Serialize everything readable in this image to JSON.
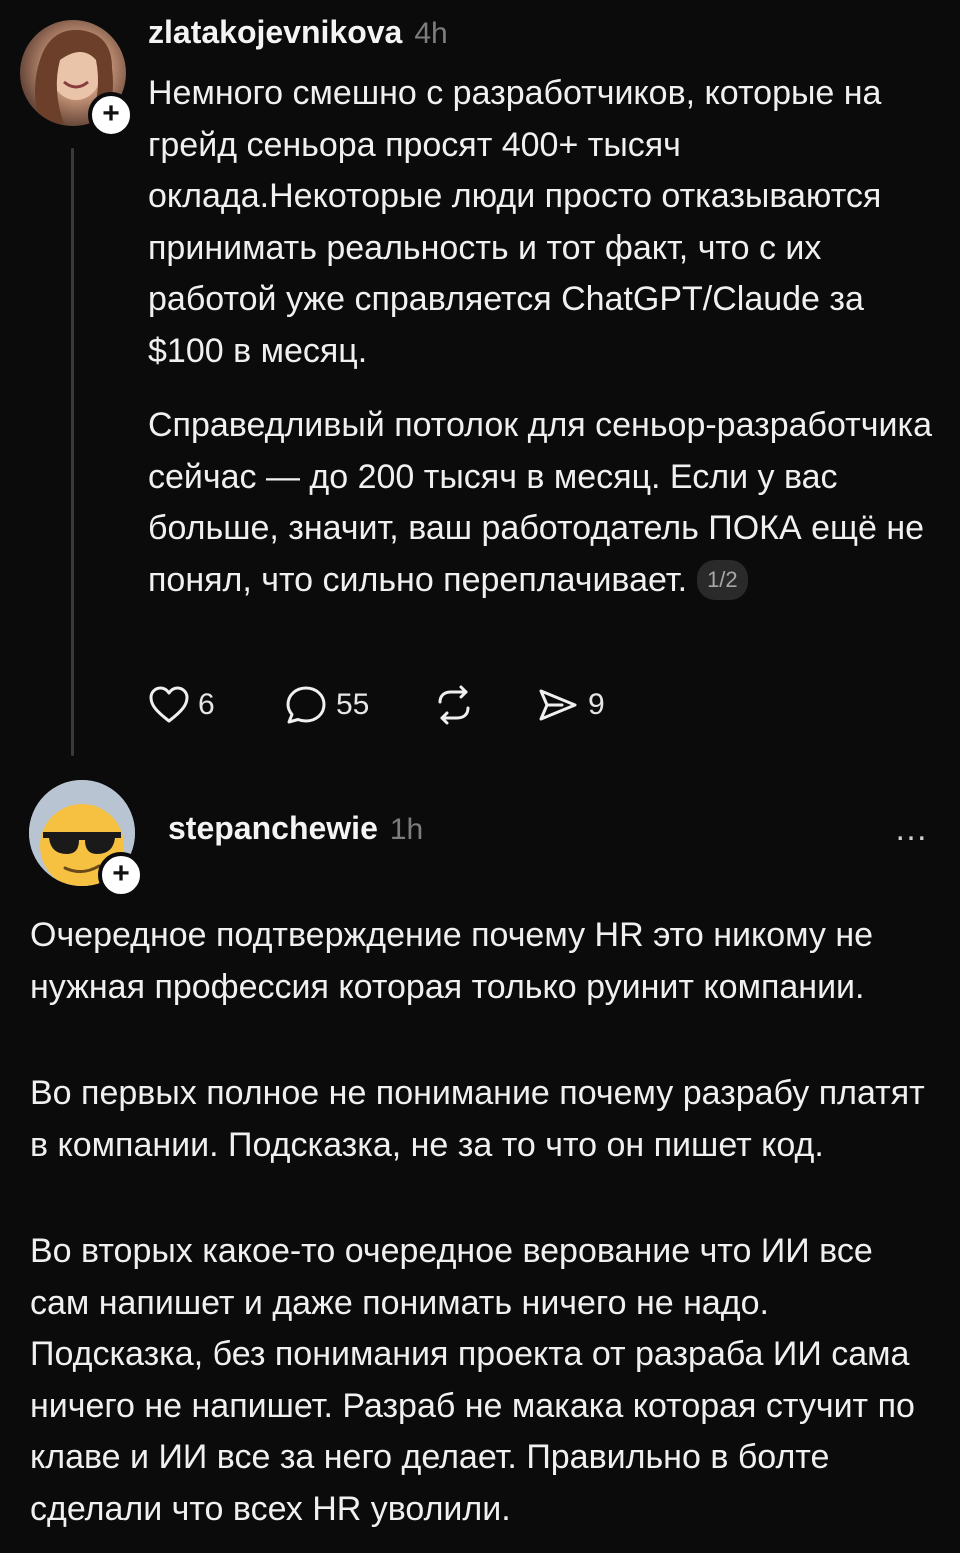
{
  "post1": {
    "username": "zlatakojevnikova",
    "time": "4h",
    "paragraph1": "Немного смешно с разработчиков, которые на грейд сеньора просят 400+ тысяч оклада.Некоторые люди просто отказываются принимать реальность и тот факт, что с их работой уже справляется ChatGPT/Claude за $100 в месяц.",
    "paragraph2": "Справедливый потолок для сеньор-разработчика сейчас — до 200 тысяч в месяц. Если у вас больше, значит, ваш работодатель ПОКА ещё не понял, что сильно переплачивает.",
    "page_indicator": "1/2",
    "actions": {
      "likes": "6",
      "replies": "55",
      "shares": "9"
    }
  },
  "post2": {
    "username": "stepanchewie",
    "time": "1h",
    "more": "…",
    "paragraph1": "Очередное подтверждение почему  HR это никому не нужная профессия которая только руинит компании.",
    "paragraph2": "Во первых полное не понимание почему разрабу платят в компании. Подсказка, не за то что он пишет код.",
    "paragraph3": "Во вторых какое-то очередное верование что ИИ все сам напишет и даже понимать ничего не надо. Подсказка, без понимания проекта от разраба ИИ сама ничего не напишет. Разраб не макака которая стучит по клаве и ИИ все за него делает. Правильно в болте сделали что всех HR уволили."
  },
  "ui": {
    "plus": "+",
    "icons": [
      "heart-icon",
      "comment-icon",
      "repost-icon",
      "share-icon",
      "more-icon",
      "plus-icon"
    ]
  }
}
